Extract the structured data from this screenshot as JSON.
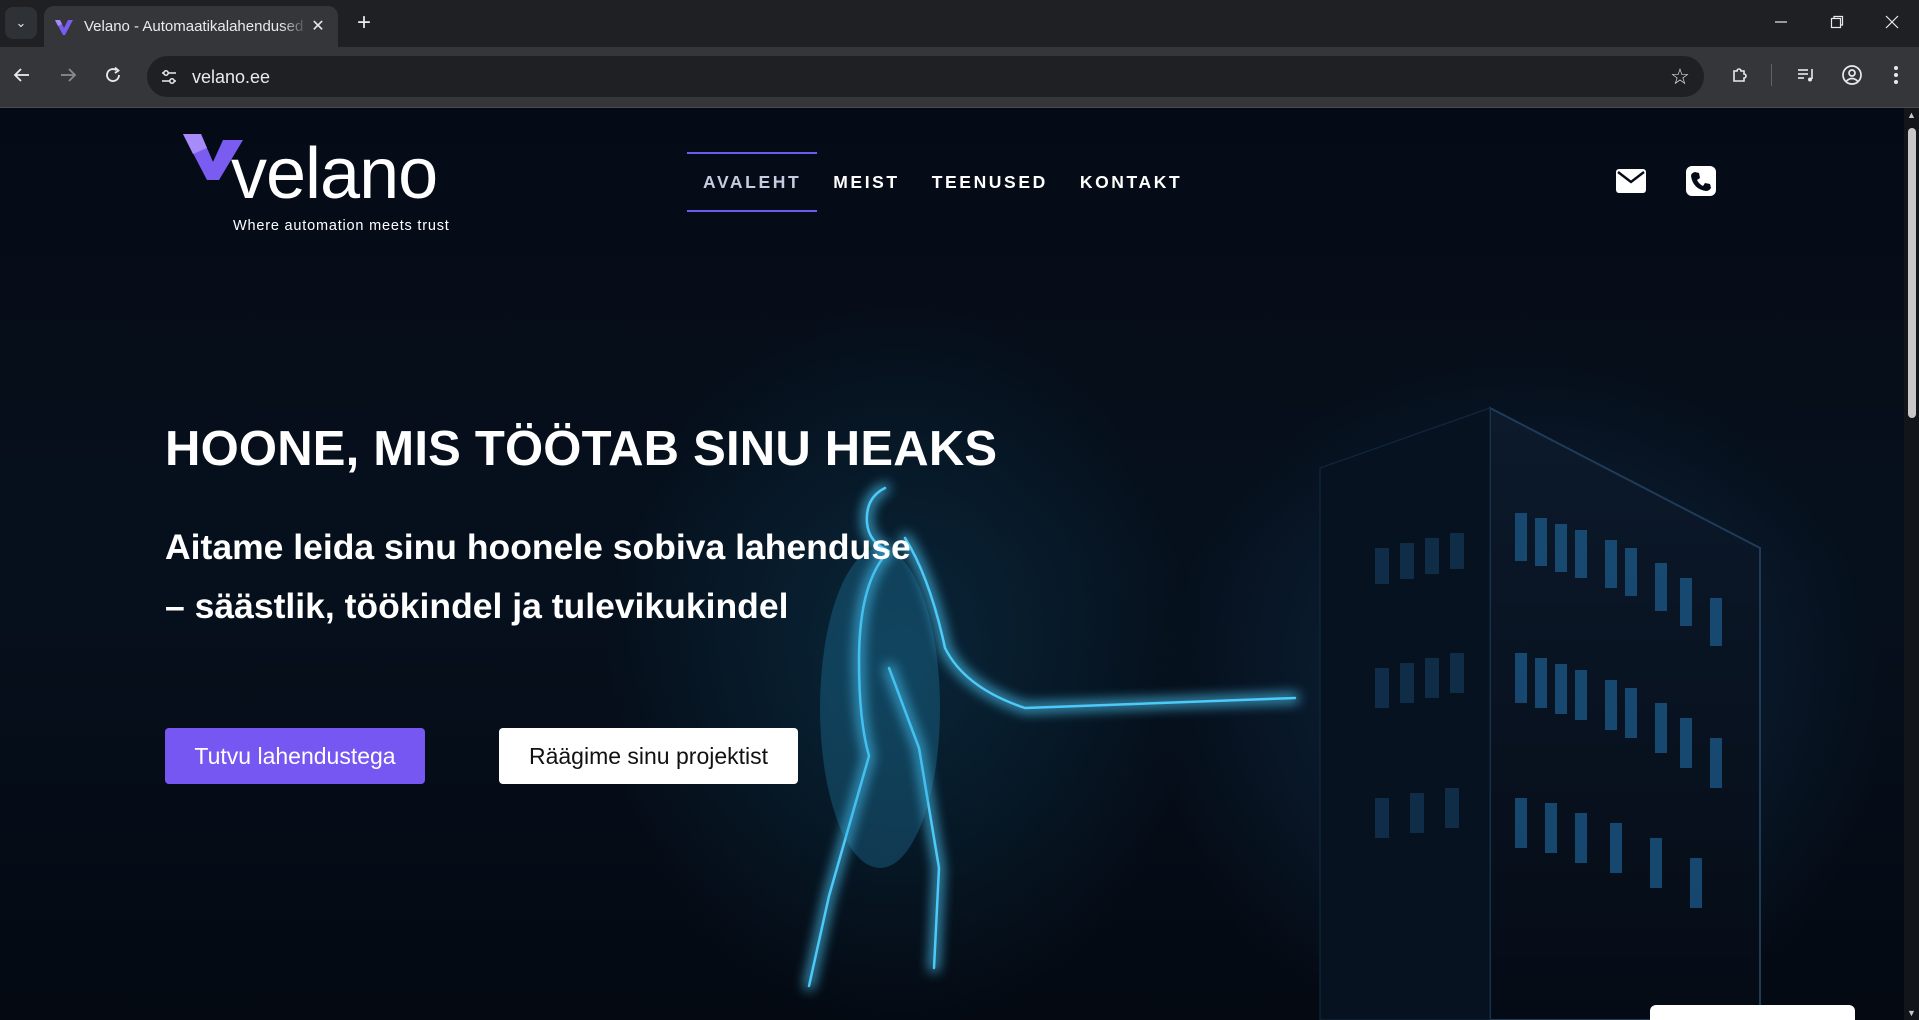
{
  "browser": {
    "tab_title": "Velano - Automaatikalahendused",
    "url": "velano.ee",
    "icons": [
      "tab-search-icon",
      "close-icon",
      "plus-icon",
      "minimize-icon",
      "restore-icon",
      "back-icon",
      "forward-icon",
      "reload-icon",
      "site-settings-icon",
      "star-icon",
      "extensions-icon",
      "media-control-icon",
      "profile-icon",
      "menu-icon"
    ]
  },
  "site": {
    "logo_word": "velano",
    "logo_tagline": "Where automation meets trust",
    "nav": [
      {
        "label": "AVALEHT",
        "active": true
      },
      {
        "label": "MEIST",
        "active": false
      },
      {
        "label": "TEENUSED",
        "active": false
      },
      {
        "label": "KONTAKT",
        "active": false
      }
    ],
    "contact_icons": [
      "mail-icon",
      "phone-icon"
    ],
    "accent_color": "#7657f2"
  },
  "hero": {
    "title": "HOONE, MIS TÖÖTAB SINU HEAKS",
    "subtitle_line1": "Aitame leida sinu hoonele sobiva lahenduse",
    "subtitle_line2": "– säästlik, töökindel ja tulevikukindel",
    "primary_cta": "Tutvu lahendustega",
    "secondary_cta": "Räägime sinu projektist"
  }
}
